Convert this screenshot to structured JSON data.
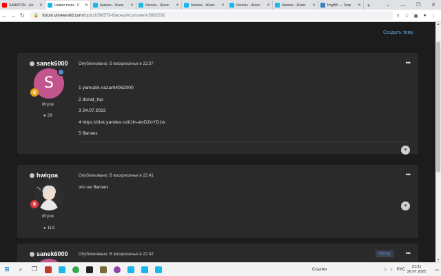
{
  "browser": {
    "tabs": [
      {
        "label": "SABATON - Нe",
        "color": "#ff0000",
        "active": false
      },
      {
        "label": "Новая тема - V",
        "color": "#1ab7ea",
        "active": true
      },
      {
        "label": "багоюз - Жалс",
        "color": "#1ab7ea",
        "active": false
      },
      {
        "label": "багоюз - Жалс",
        "color": "#1ab7ea",
        "active": false
      },
      {
        "label": "багоюз - Жалс",
        "color": "#1ab7ea",
        "active": false
      },
      {
        "label": "багоюз - Жалс",
        "color": "#1ab7ea",
        "active": false
      },
      {
        "label": "багоюз - Жалс",
        "color": "#1ab7ea",
        "active": false
      },
      {
        "label": "ImgBB — Загр",
        "color": "#3b82c4",
        "active": false
      }
    ],
    "url_host": "forum.vimeworld.com",
    "url_path": "/topic/1096579-багоюз/#comment-5892292"
  },
  "page": {
    "create_topic": "Создать тему"
  },
  "posts": [
    {
      "author": "sanek6000",
      "published": "Опубликовано: В воскресенье в 22:37",
      "avatar_letter": "S",
      "role": "Игрок",
      "count": "29",
      "lines": [
        "1 yamuzik nazar04062000",
        "2 donat_top",
        "3 24.07.2022",
        "4 https://disk.yandex.ru/i/Jin-alvDZoYD1w",
        "5 багоюз"
      ]
    },
    {
      "author": "hwiqoa",
      "published": "Опубликовано: В воскресенье в 22:41",
      "role": "Игрок",
      "count": "113",
      "lines": [
        "это не багоюз"
      ]
    },
    {
      "author": "sanek6000",
      "published": "Опубликовано: В воскресенье в 22:42",
      "badge": "Автор"
    }
  ],
  "taskbar": {
    "links_label": "Ссылки",
    "lang": "РУС",
    "time": "21:21",
    "date": "26.07.2022"
  },
  "colors": {
    "accent": "#5fa3e0",
    "avatar_s": "#c2558c",
    "online": "#5b8bd6",
    "rank_gold": "#e6a817",
    "rank_red": "#d9363e"
  }
}
